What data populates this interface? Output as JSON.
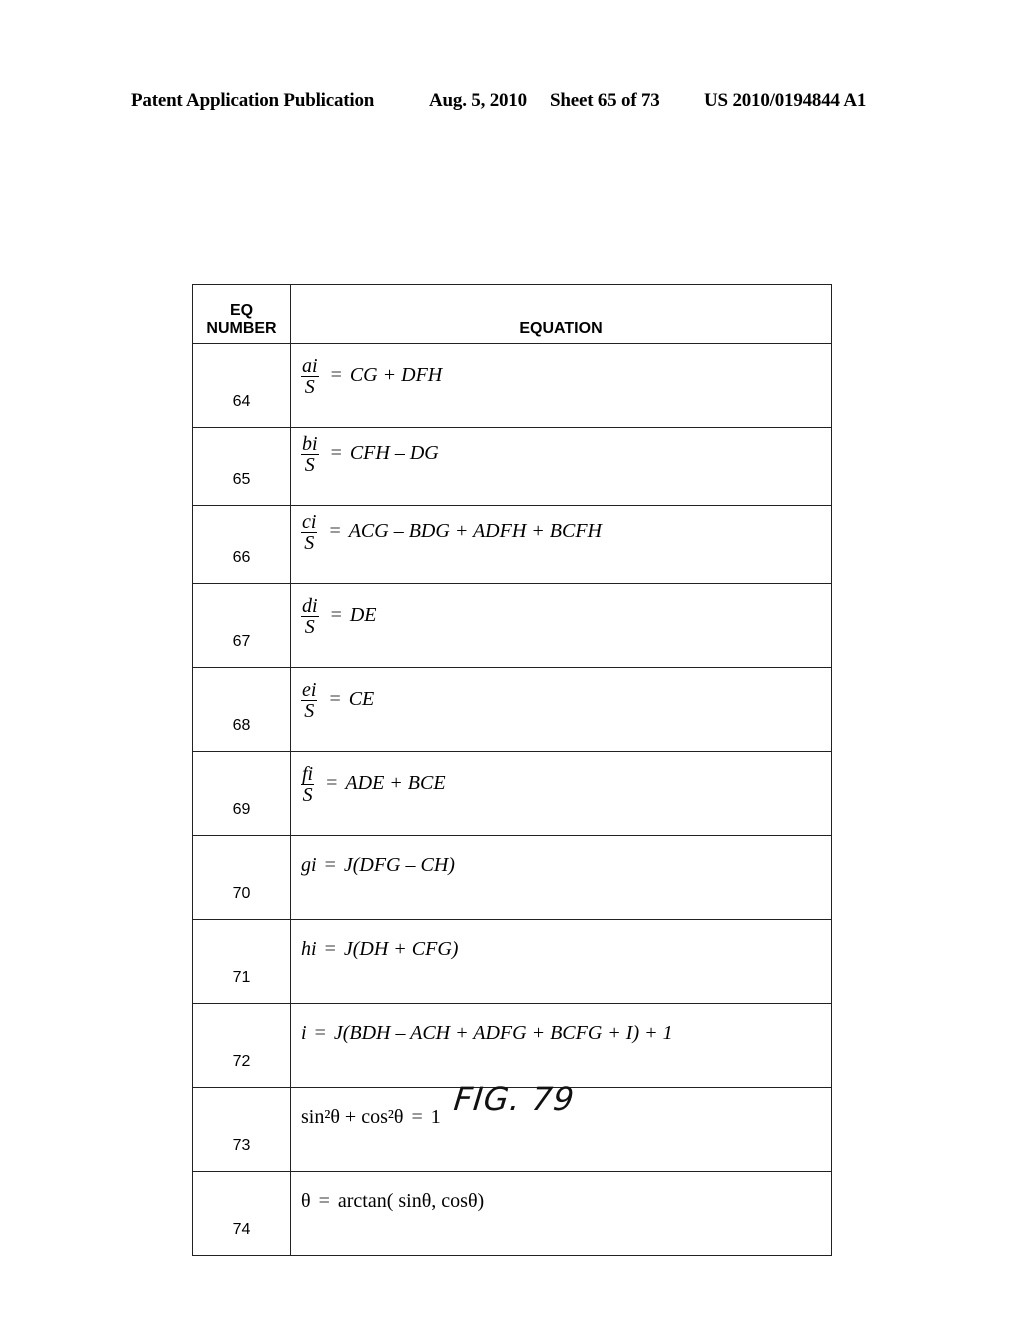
{
  "header": {
    "publication": "Patent Application Publication",
    "date": "Aug. 5, 2010",
    "sheet": "Sheet 65 of 73",
    "patent_number": "US 2010/0194844 A1"
  },
  "table": {
    "col_headers": {
      "number_line1": "EQ",
      "number_line2": "NUMBER",
      "equation": "EQUATION"
    },
    "rows": [
      {
        "number": "64",
        "numerator": "ai",
        "denominator": "S",
        "equals": "=",
        "rhs": "CG + DFH"
      },
      {
        "number": "65",
        "numerator": "bi",
        "denominator": "S",
        "equals": "=",
        "rhs": "CFH – DG"
      },
      {
        "number": "66",
        "numerator": "ci",
        "denominator": "S",
        "equals": "=",
        "rhs": "ACG – BDG + ADFH + BCFH"
      },
      {
        "number": "67",
        "numerator": "di",
        "denominator": "S",
        "equals": "=",
        "rhs": "DE"
      },
      {
        "number": "68",
        "numerator": "ei",
        "denominator": "S",
        "equals": "=",
        "rhs": "CE"
      },
      {
        "number": "69",
        "numerator": "fi",
        "denominator": "S",
        "equals": "=",
        "rhs": "ADE + BCE"
      },
      {
        "number": "70",
        "lhs": "gi",
        "equals": "=",
        "rhs": "J(DFG – CH)"
      },
      {
        "number": "71",
        "lhs": "hi",
        "equals": "=",
        "rhs": "J(DH + CFG)"
      },
      {
        "number": "72",
        "lhs": "i",
        "equals": "=",
        "rhs": "J(BDH – ACH + ADFG + BCFG + I) + 1"
      },
      {
        "number": "73",
        "lhs": "sin²θ + cos²θ",
        "equals": "=",
        "rhs": "1"
      },
      {
        "number": "74",
        "lhs": "θ",
        "equals": "=",
        "rhs": "arctan( sinθ, cosθ)"
      }
    ]
  },
  "figure_label": "FIG. 79"
}
